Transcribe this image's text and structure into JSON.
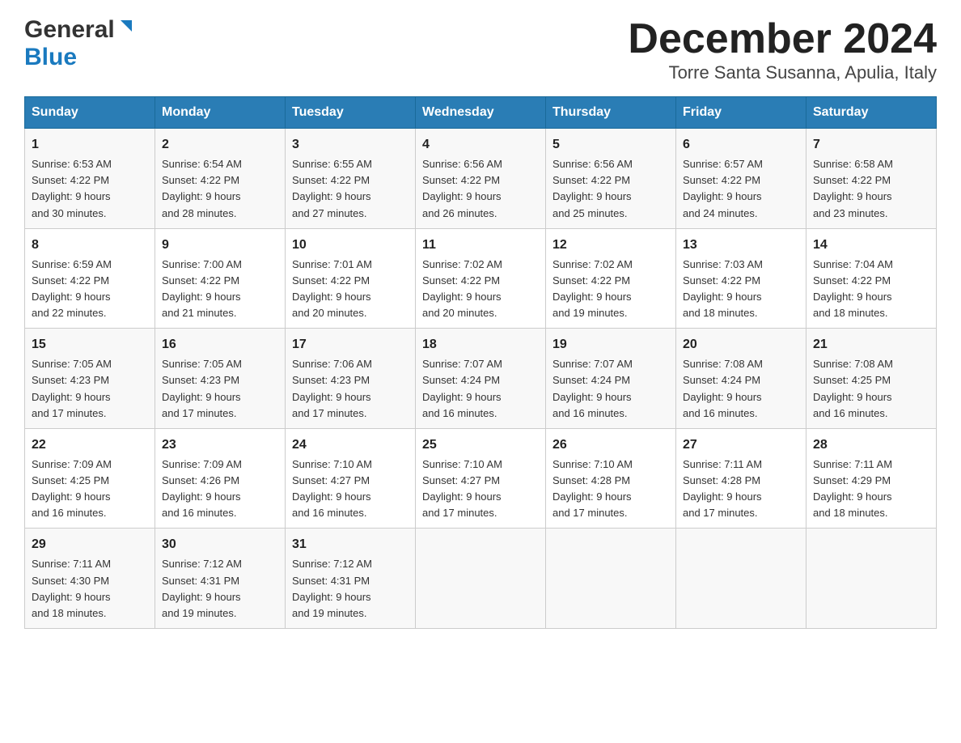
{
  "logo": {
    "general": "General",
    "blue": "Blue"
  },
  "header": {
    "month_year": "December 2024",
    "location": "Torre Santa Susanna, Apulia, Italy"
  },
  "days_of_week": [
    "Sunday",
    "Monday",
    "Tuesday",
    "Wednesday",
    "Thursday",
    "Friday",
    "Saturday"
  ],
  "weeks": [
    [
      {
        "day": "1",
        "sunrise": "6:53 AM",
        "sunset": "4:22 PM",
        "daylight": "9 hours and 30 minutes."
      },
      {
        "day": "2",
        "sunrise": "6:54 AM",
        "sunset": "4:22 PM",
        "daylight": "9 hours and 28 minutes."
      },
      {
        "day": "3",
        "sunrise": "6:55 AM",
        "sunset": "4:22 PM",
        "daylight": "9 hours and 27 minutes."
      },
      {
        "day": "4",
        "sunrise": "6:56 AM",
        "sunset": "4:22 PM",
        "daylight": "9 hours and 26 minutes."
      },
      {
        "day": "5",
        "sunrise": "6:56 AM",
        "sunset": "4:22 PM",
        "daylight": "9 hours and 25 minutes."
      },
      {
        "day": "6",
        "sunrise": "6:57 AM",
        "sunset": "4:22 PM",
        "daylight": "9 hours and 24 minutes."
      },
      {
        "day": "7",
        "sunrise": "6:58 AM",
        "sunset": "4:22 PM",
        "daylight": "9 hours and 23 minutes."
      }
    ],
    [
      {
        "day": "8",
        "sunrise": "6:59 AM",
        "sunset": "4:22 PM",
        "daylight": "9 hours and 22 minutes."
      },
      {
        "day": "9",
        "sunrise": "7:00 AM",
        "sunset": "4:22 PM",
        "daylight": "9 hours and 21 minutes."
      },
      {
        "day": "10",
        "sunrise": "7:01 AM",
        "sunset": "4:22 PM",
        "daylight": "9 hours and 20 minutes."
      },
      {
        "day": "11",
        "sunrise": "7:02 AM",
        "sunset": "4:22 PM",
        "daylight": "9 hours and 20 minutes."
      },
      {
        "day": "12",
        "sunrise": "7:02 AM",
        "sunset": "4:22 PM",
        "daylight": "9 hours and 19 minutes."
      },
      {
        "day": "13",
        "sunrise": "7:03 AM",
        "sunset": "4:22 PM",
        "daylight": "9 hours and 18 minutes."
      },
      {
        "day": "14",
        "sunrise": "7:04 AM",
        "sunset": "4:22 PM",
        "daylight": "9 hours and 18 minutes."
      }
    ],
    [
      {
        "day": "15",
        "sunrise": "7:05 AM",
        "sunset": "4:23 PM",
        "daylight": "9 hours and 17 minutes."
      },
      {
        "day": "16",
        "sunrise": "7:05 AM",
        "sunset": "4:23 PM",
        "daylight": "9 hours and 17 minutes."
      },
      {
        "day": "17",
        "sunrise": "7:06 AM",
        "sunset": "4:23 PM",
        "daylight": "9 hours and 17 minutes."
      },
      {
        "day": "18",
        "sunrise": "7:07 AM",
        "sunset": "4:24 PM",
        "daylight": "9 hours and 16 minutes."
      },
      {
        "day": "19",
        "sunrise": "7:07 AM",
        "sunset": "4:24 PM",
        "daylight": "9 hours and 16 minutes."
      },
      {
        "day": "20",
        "sunrise": "7:08 AM",
        "sunset": "4:24 PM",
        "daylight": "9 hours and 16 minutes."
      },
      {
        "day": "21",
        "sunrise": "7:08 AM",
        "sunset": "4:25 PM",
        "daylight": "9 hours and 16 minutes."
      }
    ],
    [
      {
        "day": "22",
        "sunrise": "7:09 AM",
        "sunset": "4:25 PM",
        "daylight": "9 hours and 16 minutes."
      },
      {
        "day": "23",
        "sunrise": "7:09 AM",
        "sunset": "4:26 PM",
        "daylight": "9 hours and 16 minutes."
      },
      {
        "day": "24",
        "sunrise": "7:10 AM",
        "sunset": "4:27 PM",
        "daylight": "9 hours and 16 minutes."
      },
      {
        "day": "25",
        "sunrise": "7:10 AM",
        "sunset": "4:27 PM",
        "daylight": "9 hours and 17 minutes."
      },
      {
        "day": "26",
        "sunrise": "7:10 AM",
        "sunset": "4:28 PM",
        "daylight": "9 hours and 17 minutes."
      },
      {
        "day": "27",
        "sunrise": "7:11 AM",
        "sunset": "4:28 PM",
        "daylight": "9 hours and 17 minutes."
      },
      {
        "day": "28",
        "sunrise": "7:11 AM",
        "sunset": "4:29 PM",
        "daylight": "9 hours and 18 minutes."
      }
    ],
    [
      {
        "day": "29",
        "sunrise": "7:11 AM",
        "sunset": "4:30 PM",
        "daylight": "9 hours and 18 minutes."
      },
      {
        "day": "30",
        "sunrise": "7:12 AM",
        "sunset": "4:31 PM",
        "daylight": "9 hours and 19 minutes."
      },
      {
        "day": "31",
        "sunrise": "7:12 AM",
        "sunset": "4:31 PM",
        "daylight": "9 hours and 19 minutes."
      },
      {
        "day": "",
        "sunrise": "",
        "sunset": "",
        "daylight": ""
      },
      {
        "day": "",
        "sunrise": "",
        "sunset": "",
        "daylight": ""
      },
      {
        "day": "",
        "sunrise": "",
        "sunset": "",
        "daylight": ""
      },
      {
        "day": "",
        "sunrise": "",
        "sunset": "",
        "daylight": ""
      }
    ]
  ],
  "labels": {
    "sunrise": "Sunrise:",
    "sunset": "Sunset:",
    "daylight": "Daylight:"
  }
}
